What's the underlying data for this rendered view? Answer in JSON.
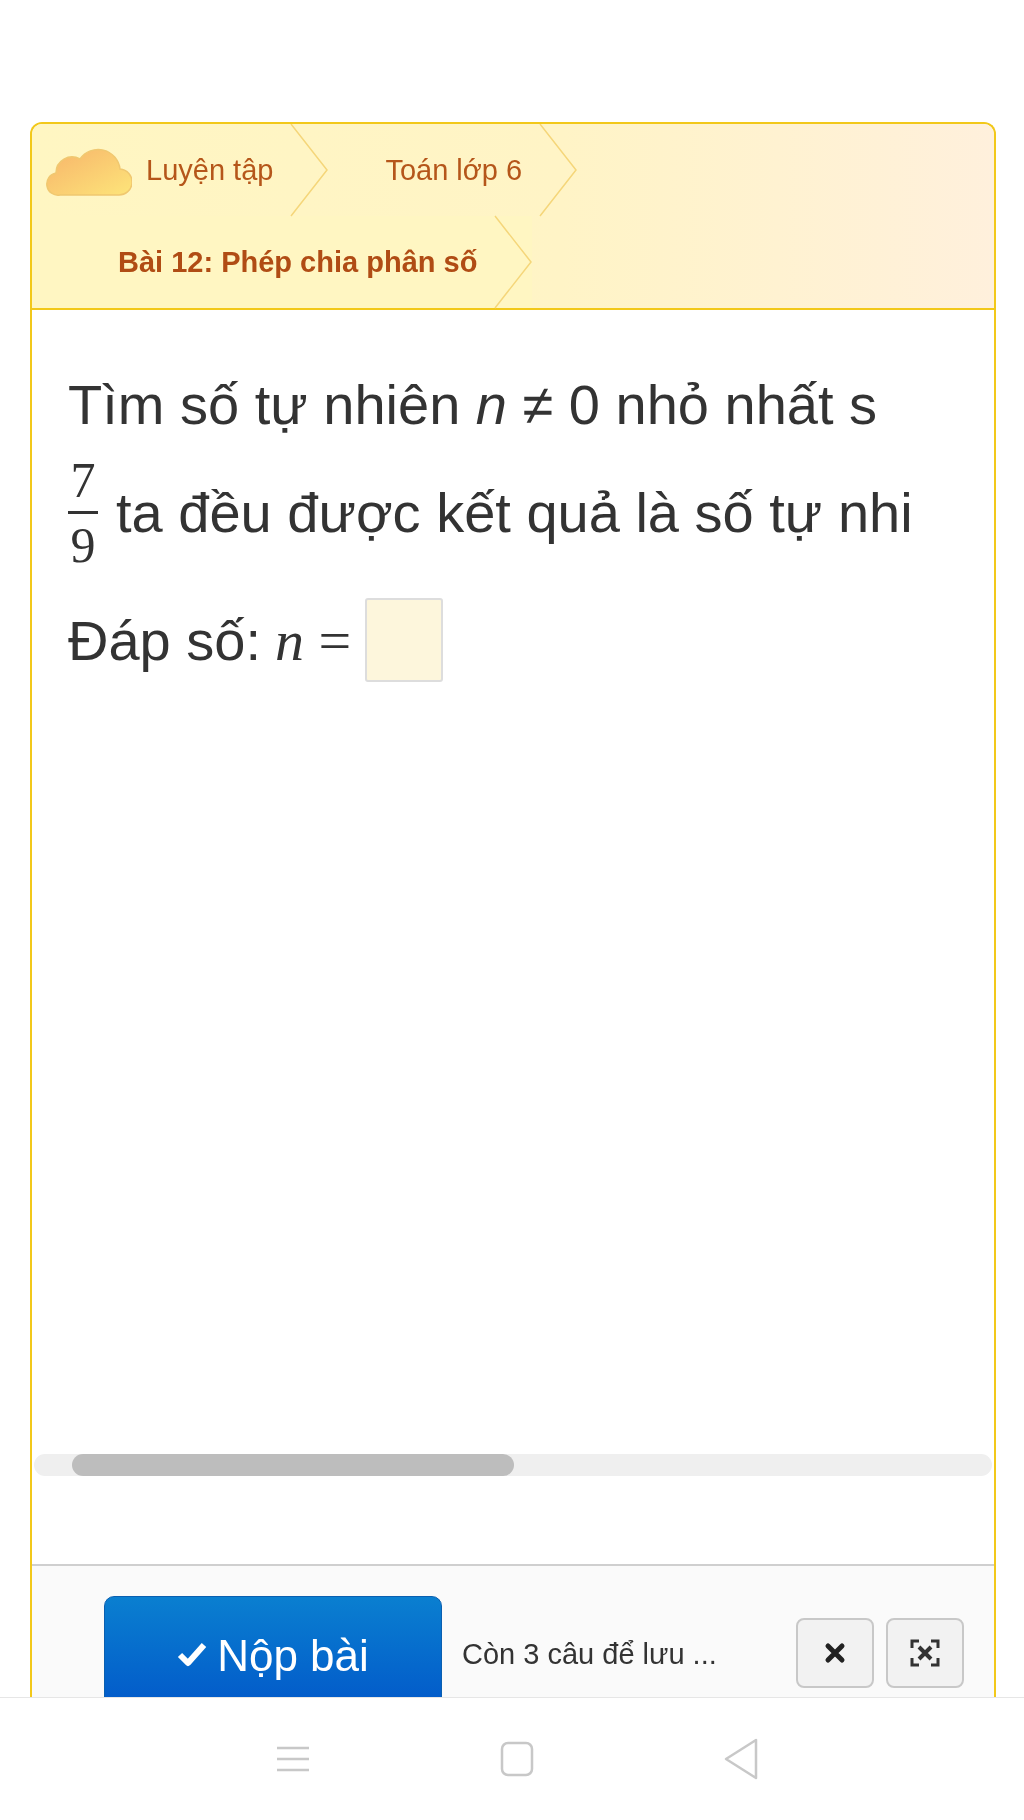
{
  "breadcrumbs": [
    {
      "label": "Luyện tập",
      "current": false
    },
    {
      "label": "Toán lớp 6",
      "current": false
    },
    {
      "label": "Bài 12: Phép chia phân số",
      "current": true
    }
  ],
  "question": {
    "line_1": "Tìm số tự nhiên *n* ≠ 0 nhỏ nhất s",
    "fraction": {
      "numerator": "7",
      "denominator": "9"
    },
    "line_2": "ta đều được kết quả là số tự nhi"
  },
  "answer": {
    "label": "Đáp số:",
    "math": "*n* ="
  },
  "footer": {
    "submit_button": "Nộp bài",
    "status": "Còn 3 câu để lưu ..."
  }
}
